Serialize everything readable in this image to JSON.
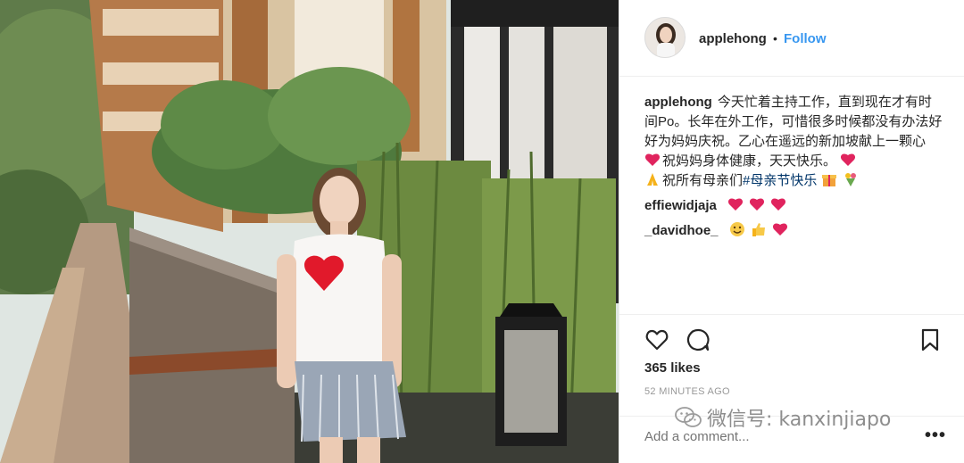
{
  "post": {
    "username": "applehong",
    "separator": "•",
    "follow_label": "Follow",
    "caption_text_1": "今天忙着主持工作，直到现在才有时间Po。长年在外工作，可惜很多时候都没有办法好好为妈妈庆祝。乙心在遥远的新加坡献上一颗心",
    "caption_text_2": "祝妈妈身体健康，天天快乐。",
    "caption_text_3": "祝所有母亲们",
    "hashtag": "#母亲节快乐",
    "comments": [
      {
        "username": "effiewidjaja"
      },
      {
        "username": "_davidhoe_"
      }
    ],
    "likes": "365 likes",
    "time": "52 MINUTES AGO",
    "add_comment_placeholder": "Add a comment...",
    "more_label": "•••"
  },
  "icons": {
    "heart": "heart-icon",
    "comment": "comment-icon",
    "bookmark": "bookmark-icon",
    "red_heart": "red-heart-emoji",
    "pray": "pray-emoji",
    "gift": "gift-emoji",
    "bouquet": "bouquet-emoji",
    "smile": "smile-emoji",
    "thumbs_up": "thumbs-up-emoji"
  },
  "colors": {
    "accent": "#3897f0",
    "text": "#262626",
    "muted": "#999999",
    "emoji_red": "#e0245e"
  },
  "watermark": {
    "text": "微信号: kanxinjiapo"
  }
}
